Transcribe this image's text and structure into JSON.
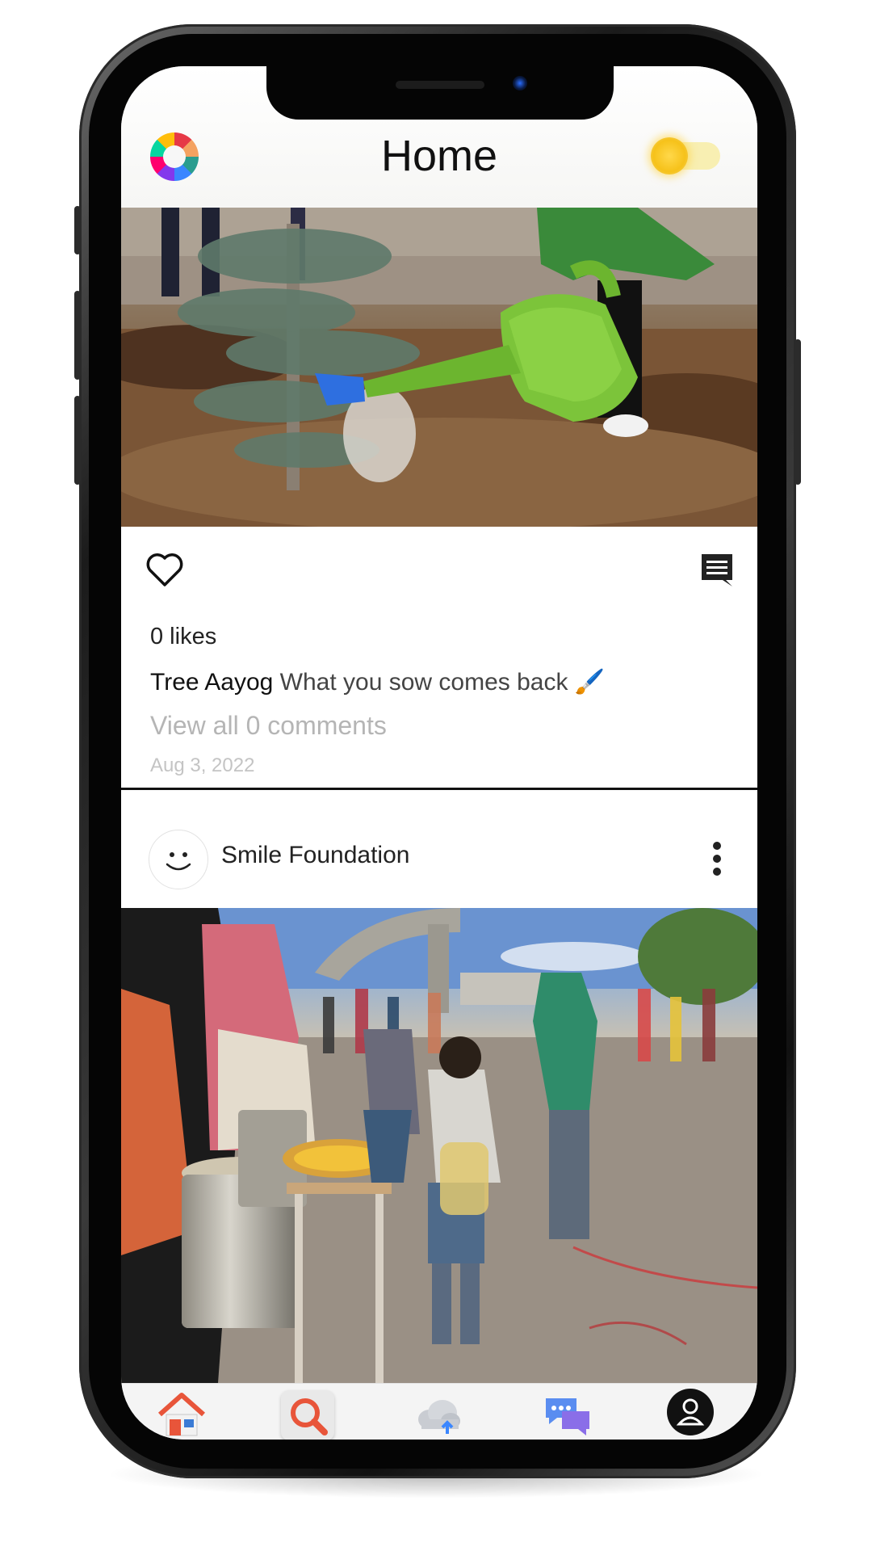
{
  "header": {
    "title": "Home",
    "logo_icon": "flower-logo-icon",
    "theme_toggle_icon": "sun-icon"
  },
  "post1": {
    "image": "child-watering-tree-photo",
    "likes": "0 likes",
    "username": "Tree Aayog",
    "caption": "What you sow comes back",
    "caption_emoji": "🖌️",
    "view_comments": "View all 0 comments",
    "date": "Aug 3, 2022"
  },
  "post2": {
    "author": "Smile Foundation",
    "avatar_icon": "smiley-face-icon",
    "image": "food-distribution-photo"
  },
  "bottom_nav": {
    "items": [
      {
        "name": "home",
        "icon": "home-icon"
      },
      {
        "name": "search",
        "icon": "search-icon"
      },
      {
        "name": "upload",
        "icon": "cloud-upload-icon"
      },
      {
        "name": "messages",
        "icon": "chat-icon"
      },
      {
        "name": "profile",
        "icon": "profile-icon"
      }
    ]
  }
}
